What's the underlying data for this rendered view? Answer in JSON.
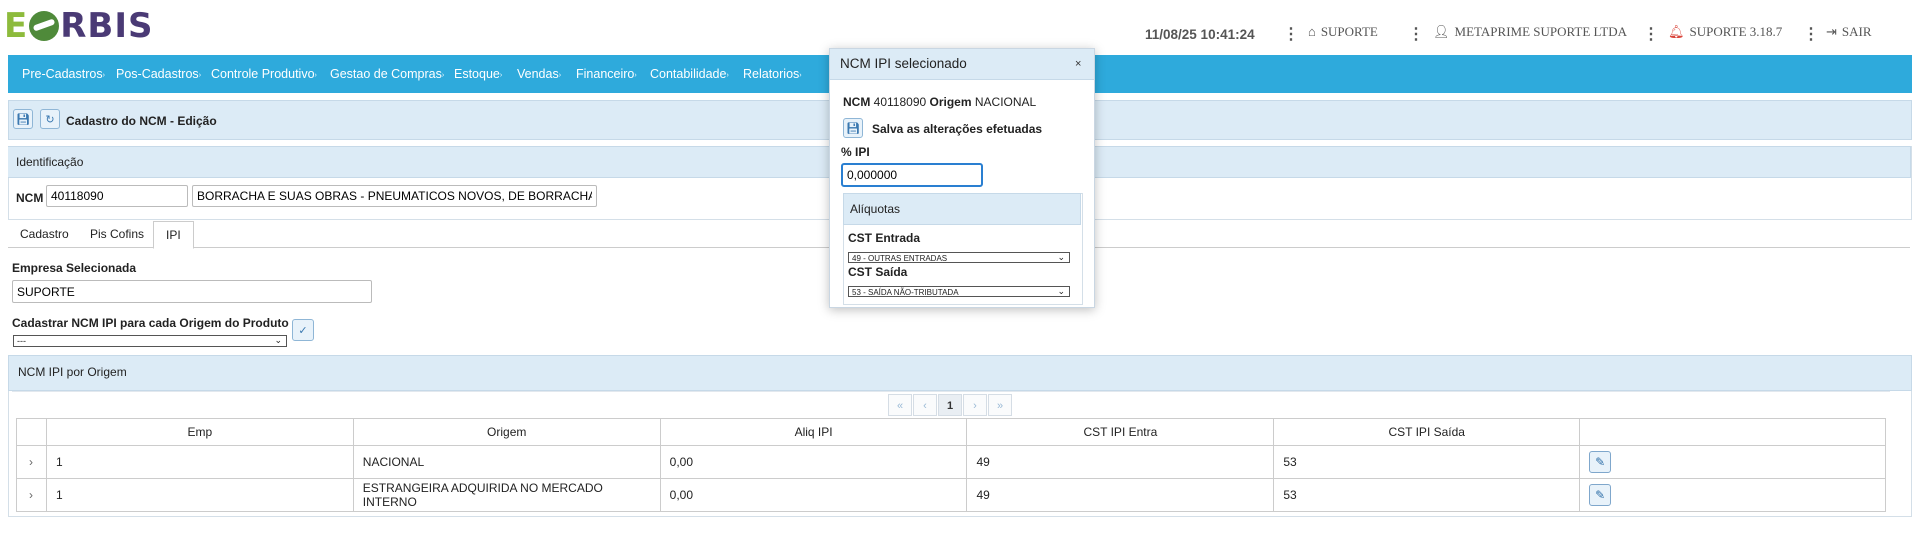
{
  "app": {
    "logo_prefix": "E",
    "logo_suffix": "RBIS"
  },
  "header": {
    "datetime": "11/08/25 10:41:24",
    "home_label": "SUPORTE",
    "user_label": "METAPRIME SUPORTE LTDA",
    "version_label": "SUPORTE 3.18.7",
    "logout_label": "SAIR"
  },
  "menu": [
    "Pre-Cadastros",
    "Pos-Cadastros",
    "Controle Produtivo",
    "Gestao de Compras",
    "Estoque",
    "Vendas",
    "Financeiro",
    "Contabilidade",
    "Relatorios"
  ],
  "page": {
    "title": "Cadastro do NCM - Edição",
    "section_identificacao": "Identificação",
    "ncm_label": "NCM",
    "ncm_value": "40118090",
    "ncm_description": "BORRACHA E SUAS OBRAS - PNEUMATICOS NOVOS, DE BORRACHA - OUTR"
  },
  "tabs": [
    "Cadastro",
    "Pis Cofins",
    "IPI"
  ],
  "ipi": {
    "empresa_label": "Empresa Selecionada",
    "empresa_value": "SUPORTE",
    "origem_label": "Cadastrar NCM IPI para cada Origem do Produto",
    "origem_value": "---",
    "table_title": "NCM IPI por Origem",
    "pager": {
      "first": "«",
      "prev": "‹",
      "current": "1",
      "next": "›",
      "last": "»"
    },
    "columns": [
      "Emp",
      "Origem",
      "Aliq IPI",
      "CST IPI Entra",
      "CST IPI Saída"
    ],
    "rows": [
      {
        "emp": "1",
        "origem": "NACIONAL",
        "aliq": "0,00",
        "cst_entra": "49",
        "cst_saida": "53"
      },
      {
        "emp": "1",
        "origem": "ESTRANGEIRA ADQUIRIDA NO MERCADO INTERNO",
        "aliq": "0,00",
        "cst_entra": "49",
        "cst_saida": "53"
      }
    ]
  },
  "popup": {
    "title": "NCM IPI selecionado",
    "close": "×",
    "ncm_label": "NCM",
    "ncm_value": "40118090",
    "origem_label": "Origem",
    "origem_value": "NACIONAL",
    "save_text": "Salva as alterações efetuadas",
    "ipi_label": "% IPI",
    "ipi_value": "0,000000",
    "aliquotas_title": "Alíquotas",
    "cst_entrada_label": "CST Entrada",
    "cst_entrada_value": "49 - OUTRAS ENTRADAS",
    "cst_saida_label": "CST Saída",
    "cst_saida_value": "53 - SAÍDA NÃO-TRIBUTADA"
  },
  "colors": {
    "menubar": "#2eaadc",
    "panel_header": "#dcebf6",
    "logo_green": "#8dbb3c",
    "logo_purple": "#4a3a75",
    "bell_red": "#d9443a"
  }
}
